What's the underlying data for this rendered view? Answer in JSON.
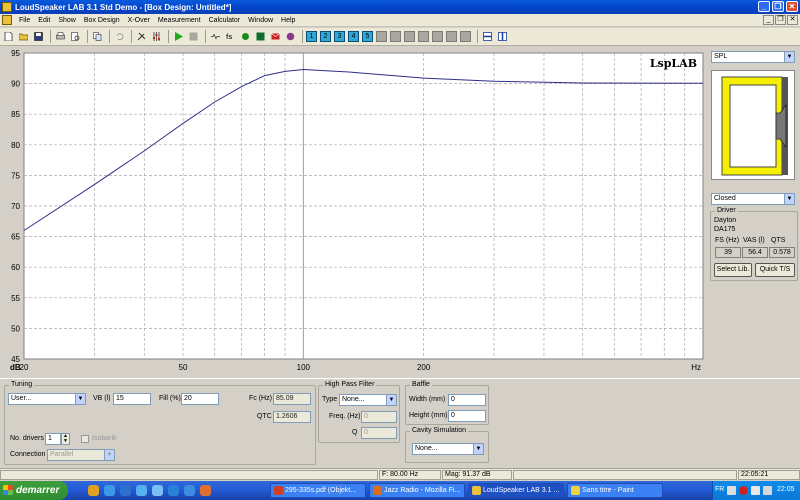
{
  "window": {
    "title": "LoudSpeaker LAB 3.1 Std Demo - [Box Design: Untitled*]",
    "controls": [
      "_",
      "❐",
      "✕"
    ]
  },
  "menu": [
    "File",
    "Edit",
    "Show",
    "Box Design",
    "X-Over",
    "Measurement",
    "Calculator",
    "Window",
    "Help"
  ],
  "toolbar": {
    "numbers": [
      "1",
      "2",
      "3",
      "4",
      "5"
    ]
  },
  "plot": {
    "watermark": "LspLAB",
    "y_unit": "dB",
    "x_unit": "Hz",
    "colors": {
      "background": "#ffffff",
      "grid": "#a8a8a8",
      "curve": "#2e2e8a",
      "cursor": "#a0a0a0"
    }
  },
  "chart_data": {
    "type": "line",
    "x_scale": "log",
    "xlim": [
      20,
      1000
    ],
    "ylim": [
      45,
      95
    ],
    "x_ticks": [
      20,
      50,
      100,
      200
    ],
    "y_ticks": [
      45,
      50,
      55,
      60,
      65,
      70,
      75,
      80,
      85,
      90,
      95
    ],
    "grid": true,
    "cursor_x": 100,
    "series": [
      {
        "points": [
          [
            20,
            66
          ],
          [
            30,
            73.5
          ],
          [
            40,
            79
          ],
          [
            50,
            83.5
          ],
          [
            60,
            87
          ],
          [
            70,
            89.5
          ],
          [
            80,
            91.3
          ],
          [
            90,
            92
          ],
          [
            100,
            92.3
          ],
          [
            130,
            91.9
          ],
          [
            200,
            90.9
          ],
          [
            300,
            90.4
          ],
          [
            500,
            90.1
          ],
          [
            1000,
            90.05
          ]
        ]
      }
    ]
  },
  "right_panel": {
    "view_select": "SPL",
    "box_type_select": "Closed",
    "driver": {
      "group_label": "Driver",
      "brand": "Dayton",
      "model": "DA175",
      "headers": [
        "FS (Hz)",
        "VAS (l)",
        "QTS"
      ],
      "values": [
        "39",
        "56.4",
        "0.578"
      ]
    },
    "select_lib_label": "Select Lib.",
    "quick_ts_label": "Quick T/S"
  },
  "tuning": {
    "group_label": "Tuning",
    "preset": "User...",
    "vb_label": "VB (l)",
    "vb_value": "15",
    "fill_label": "Fill (%)",
    "fill_value": "20",
    "fc_label": "Fc (Hz)",
    "fc_value": "85.09",
    "qtc_label": "QTC",
    "qtc_value": "1.2606",
    "drivers_label": "No. drivers",
    "drivers_value": "1",
    "isobarik_label": "Isobarik",
    "connection_label": "Connection",
    "connection_value": "Parallel"
  },
  "highpass": {
    "group_label": "High Pass Filter",
    "type_label": "Type",
    "type_value": "None...",
    "freq_label": "Freq. (Hz)",
    "freq_value": "0",
    "q_label": "Q",
    "q_value": "0"
  },
  "baffle": {
    "group_label": "Baffle",
    "width_label": "Width (mm)",
    "width_value": "0",
    "height_label": "Height (mm)",
    "height_value": "0"
  },
  "cavity": {
    "group_label": "Cavity Simulation",
    "value": "None..."
  },
  "status": {
    "freq": "F: 80.00 Hz",
    "mag": "Mag: 91.37 dB",
    "time": "22:05:21"
  },
  "taskbar": {
    "start_label": "demarrer",
    "tasks": [
      "295-335s.pdf (Objekt...",
      "Jazz Radio - Mozilla Fi...",
      "LoudSpeaker LAB 3.1 ...",
      "Sans titre - Paint"
    ],
    "lang": "FR",
    "clock": "22:05"
  }
}
